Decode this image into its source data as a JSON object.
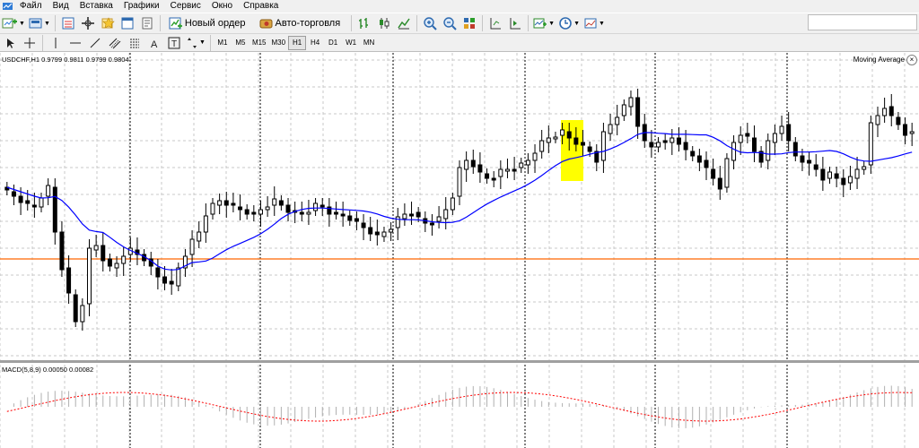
{
  "menubar": {
    "items": [
      "Файл",
      "Вид",
      "Вставка",
      "Графики",
      "Сервис",
      "Окно",
      "Справка"
    ]
  },
  "toolbar": {
    "new_order_label": "Новый ордер",
    "auto_trading_label": "Авто-торговля",
    "search_placeholder": ""
  },
  "timeframes": [
    "M1",
    "M5",
    "M15",
    "M30",
    "H1",
    "H4",
    "D1",
    "W1",
    "MN"
  ],
  "active_timeframe": "H1",
  "chart": {
    "symbol_info": "USDCHF,H1  0.9799 0.9811 0.9799 0.9804",
    "indicator_label": "Moving Average",
    "close_symbol": "×",
    "macd_label": "MACD(5,8,9) 0.00050 0.00082"
  },
  "colors": {
    "candle": "#000000",
    "moving_average": "#0000ff",
    "level_line": "#ff6600",
    "highlight": "#ffff00",
    "macd_signal": "#ff0000",
    "grid": "#c8c8c8"
  }
}
